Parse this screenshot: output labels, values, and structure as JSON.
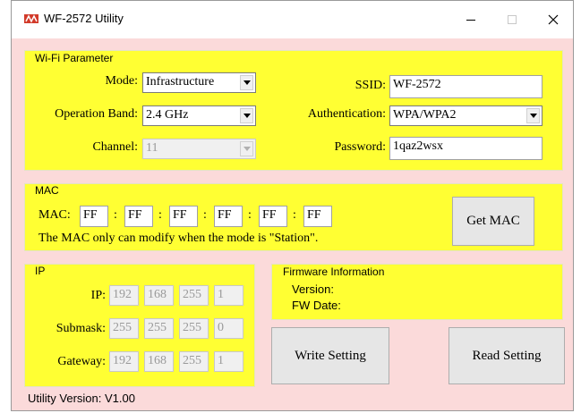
{
  "window": {
    "title": "WF-2572 Utility",
    "icon": "icpdas-logo-icon"
  },
  "wifi": {
    "legend": "Wi-Fi Parameter",
    "mode_label": "Mode:",
    "mode_value": "Infrastructure",
    "band_label": "Operation Band:",
    "band_value": "2.4 GHz",
    "channel_label": "Channel:",
    "channel_value": "11",
    "ssid_label": "SSID:",
    "ssid_value": "WF-2572",
    "auth_label": "Authentication:",
    "auth_value": "WPA/WPA2",
    "password_label": "Password:",
    "password_value": "1qaz2wsx"
  },
  "mac": {
    "legend": "MAC",
    "label": "MAC:",
    "octets": [
      "FF",
      "FF",
      "FF",
      "FF",
      "FF",
      "FF"
    ],
    "sep": ":",
    "note": "The MAC only can modify when the mode is \"Station\".",
    "get_button": "Get MAC"
  },
  "ip": {
    "legend": "IP",
    "ip_label": "IP:",
    "ip": [
      "192",
      "168",
      "255",
      "1"
    ],
    "submask_label": "Submask:",
    "submask": [
      "255",
      "255",
      "255",
      "0"
    ],
    "gateway_label": "Gateway:",
    "gateway": [
      "192",
      "168",
      "255",
      "1"
    ]
  },
  "firmware": {
    "legend": "Firmware Information",
    "version_label": "Version:",
    "date_label": "FW Date:"
  },
  "actions": {
    "write": "Write Setting",
    "read": "Read Setting"
  },
  "status": {
    "utility_version": "Utility Version: V1.00"
  },
  "colors": {
    "panel": "#ffff33",
    "window_bg": "#fbdada"
  }
}
